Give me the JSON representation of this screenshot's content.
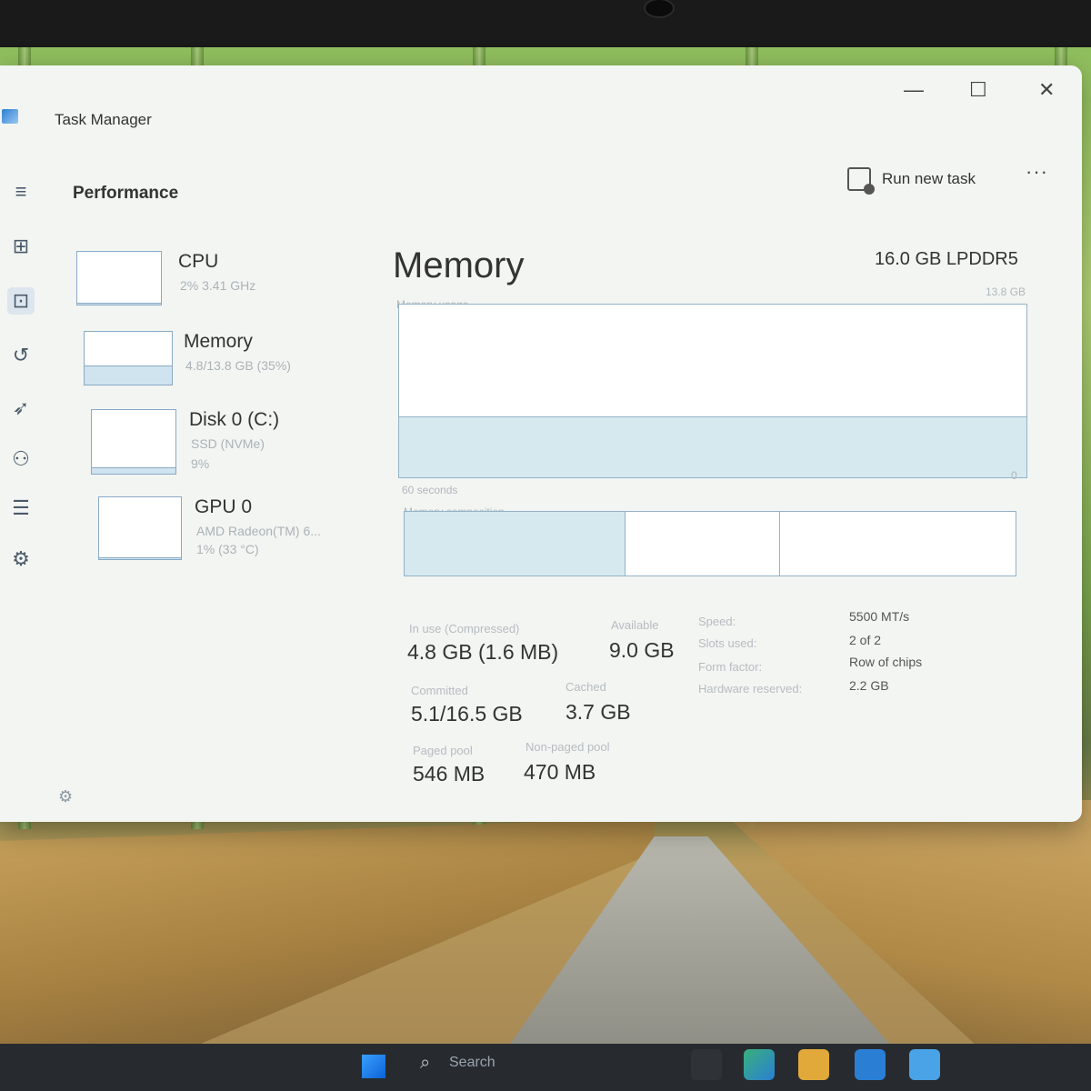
{
  "window": {
    "title": "Task Manager",
    "minimize_glyph": "—",
    "maximize_glyph": "☐",
    "close_glyph": "✕"
  },
  "header": {
    "page_title": "Performance",
    "run_new_task_label": "Run new task",
    "more_glyph": "···"
  },
  "nav_icons": [
    "hamburger-icon",
    "processes-icon",
    "performance-icon",
    "app-history-icon",
    "startup-apps-icon",
    "users-icon",
    "details-icon",
    "services-icon"
  ],
  "perf_list": [
    {
      "name": "CPU",
      "sub": "2% 3.41 GHz",
      "sub2": "",
      "fill": 0.02
    },
    {
      "name": "Memory",
      "sub": "4.8/13.8 GB (35%)",
      "sub2": "",
      "fill": 0.35
    },
    {
      "name": "Disk 0 (C:)",
      "sub": "SSD (NVMe)",
      "sub2": "9%",
      "fill": 0.09
    },
    {
      "name": "GPU 0",
      "sub": "AMD Radeon(TM) 6...",
      "sub2": "1% (33 °C)",
      "fill": 0.01
    }
  ],
  "memory": {
    "title": "Memory",
    "type": "16.0 GB LPDDR5",
    "usage_label": "Memory usage",
    "usage_max": "13.8 GB",
    "usage_time": "60 seconds",
    "usage_min": "0",
    "usage_fraction": 0.35,
    "composition_label": "Memory composition",
    "stats": {
      "in_use_label": "In use (Compressed)",
      "in_use_value": "4.8 GB (1.6 MB)",
      "available_label": "Available",
      "available_value": "9.0 GB",
      "committed_label": "Committed",
      "committed_value": "5.1/16.5 GB",
      "cached_label": "Cached",
      "cached_value": "3.7 GB",
      "paged_label": "Paged pool",
      "paged_value": "546 MB",
      "nonpaged_label": "Non-paged pool",
      "nonpaged_value": "470 MB"
    },
    "specs": {
      "speed_label": "Speed:",
      "speed_value": "5500 MT/s",
      "slots_label": "Slots used:",
      "slots_value": "2 of 2",
      "form_label": "Form factor:",
      "form_value": "Row of chips",
      "reserved_label": "Hardware reserved:",
      "reserved_value": "2.2 GB"
    }
  },
  "taskbar": {
    "search_placeholder": "Search"
  },
  "colors": {
    "accent_fill": "#cfe4ef",
    "graph_border": "#8aaac4"
  }
}
